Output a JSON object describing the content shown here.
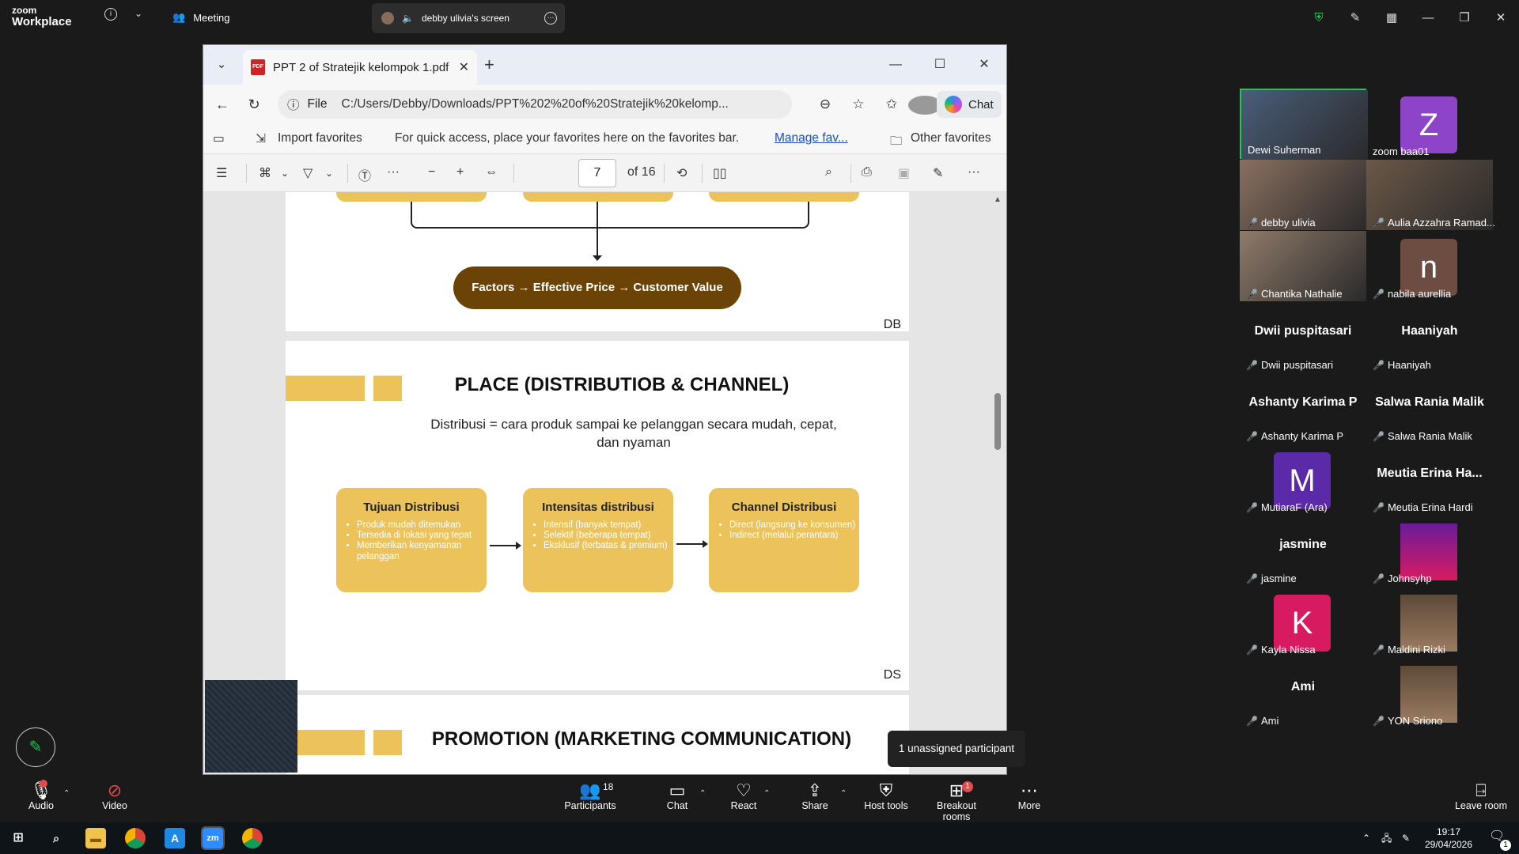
{
  "zoom": {
    "logo_line1": "zoom",
    "logo_line2": "Workplace",
    "meeting_label": "Meeting",
    "screen_label": "debby ulivia's screen"
  },
  "browser": {
    "tab_title": "PPT 2 of Stratejik kelompok 1.pdf",
    "file_label": "File",
    "url": "C:/Users/Debby/Downloads/PPT%202%20of%20Stratejik%20kelomp...",
    "chat_label": "Chat",
    "import_favorites": "Import favorites",
    "favorites_hint": "For quick access, place your favorites here on the favorites bar.",
    "manage_favorites": "Manage fav...",
    "other_favorites": "Other favorites",
    "page_number": "7",
    "page_total": "of 16"
  },
  "slide_price": {
    "bar_text": "Factors → Effective Price → Customer Value",
    "initials": "DB"
  },
  "slide_place": {
    "title": "PLACE (DISTRIBUTIOB & CHANNEL)",
    "subtitle_line1": "Distribusi = cara produk sampai ke pelanggan secara mudah, cepat,",
    "subtitle_line2": "dan nyaman",
    "boxes": [
      {
        "title": "Tujuan Distribusi",
        "items": [
          "Produk mudah ditemukan",
          "Tersedia di lokasi yang tepat",
          "Memberikan kenyamanan pelanggan"
        ]
      },
      {
        "title": "Intensitas distribusi",
        "items": [
          "Intensif (banyak tempat)",
          "Selektif (beberapa tempat)",
          "Eksklusif (terbatas & premium)"
        ]
      },
      {
        "title": "Channel Distribusi",
        "items": [
          "Direct (langsung ke konsumen)",
          "Indirect (melalui perantara)"
        ]
      }
    ],
    "initials": "DS"
  },
  "slide_promotion": {
    "title": "PROMOTION (MARKETING COMMUNICATION)"
  },
  "participants": [
    {
      "name": "Dewi Suherman",
      "type": "video",
      "muted": false
    },
    {
      "name": "zoom baa01",
      "type": "letter",
      "letter": "Z",
      "color": "#8e44c8",
      "muted": false
    },
    {
      "name": "debby ulivia",
      "type": "video",
      "muted": true
    },
    {
      "name": "Aulia Azzahra Ramad...",
      "type": "video",
      "muted": true
    },
    {
      "name": "Chantika Nathalie",
      "type": "video",
      "muted": true
    },
    {
      "name": "nabila aurellia",
      "type": "letter",
      "letter": "n",
      "color": "#6d4c41",
      "muted": true
    },
    {
      "name": "Dwii puspitasari",
      "type": "name",
      "big": "Dwii puspitasari",
      "muted": true
    },
    {
      "name": "Haaniyah",
      "type": "name",
      "big": "Haaniyah",
      "muted": true
    },
    {
      "name": "Ashanty Karima P",
      "type": "name",
      "big": "Ashanty Karima P",
      "muted": true
    },
    {
      "name": "Salwa Rania Malik",
      "type": "name",
      "big": "Salwa Rania Malik",
      "muted": true
    },
    {
      "name": "MutiaraF (Ara)",
      "type": "letter",
      "letter": "M",
      "color": "#5b2aa8",
      "muted": true
    },
    {
      "name": "Meutia Erina Hardi",
      "type": "name",
      "big": "Meutia Erina Ha...",
      "muted": true
    },
    {
      "name": "jasmine",
      "type": "name",
      "big": "jasmine",
      "muted": true
    },
    {
      "name": "Johnsyhp",
      "type": "video",
      "muted": true
    },
    {
      "name": "Kayla Nissa",
      "type": "letter",
      "letter": "K",
      "color": "#d81b60",
      "muted": true
    },
    {
      "name": "Maldini Rizki",
      "type": "video",
      "muted": true
    },
    {
      "name": "Ami",
      "type": "name",
      "big": "Ami",
      "muted": true
    },
    {
      "name": "YON Sriono",
      "type": "video",
      "muted": true
    }
  ],
  "toolbar": {
    "audio": "Audio",
    "video": "Video",
    "participants": "Participants",
    "participants_count": "18",
    "chat": "Chat",
    "react": "React",
    "share": "Share",
    "host_tools": "Host tools",
    "breakout_rooms": "Breakout rooms",
    "breakout_badge": "1",
    "more": "More",
    "leave_room": "Leave room",
    "tooltip": "1 unassigned participant"
  },
  "taskbar": {
    "time": "19:17",
    "date": "29/04/2026",
    "notif": "1"
  },
  "colors": {
    "slide_yellow": "#ecc35a",
    "price_bar": "#6b4306",
    "zoom_bg": "#1a1a1a",
    "muted_red": "#e5484d"
  }
}
